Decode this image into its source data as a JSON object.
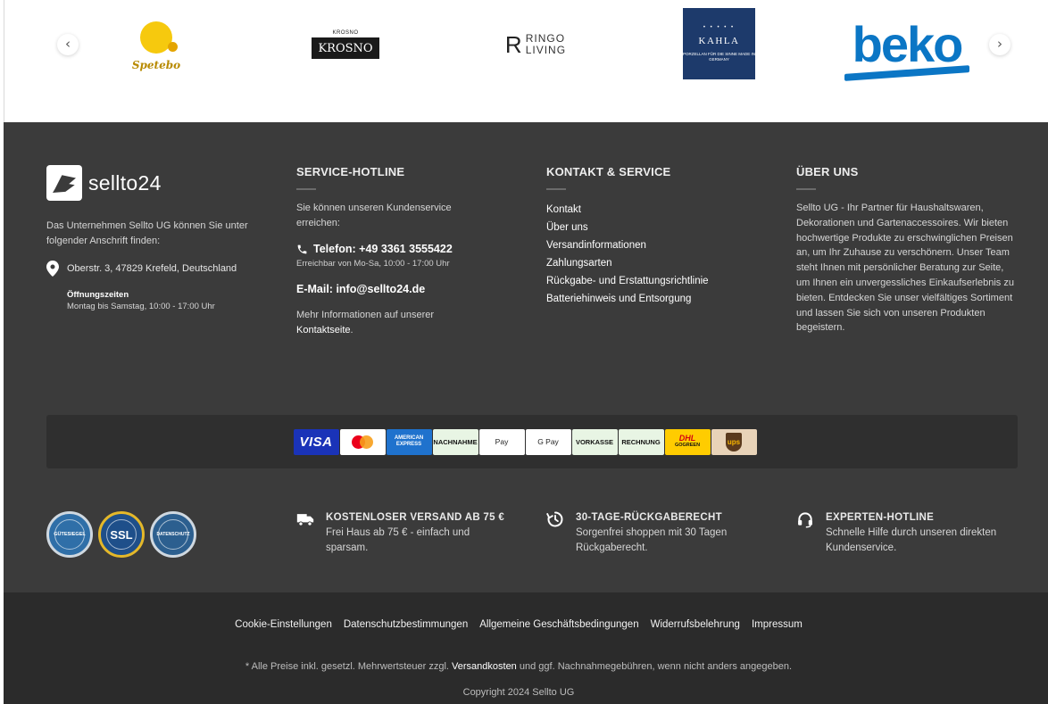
{
  "brands": {
    "prev_label": "‹",
    "next_label": "›",
    "spetebo": "Spetebo",
    "krosno_top": "KROSNO",
    "krosno": "KROSNO",
    "ringo_mark": "R",
    "ringo_line1": "RINGO",
    "ringo_line2": "LIVING",
    "kahla_stars": "• • • • •",
    "kahla": "KAHLA",
    "kahla_sub": "PORZELLAN FÜR DIE SINNE MADE IN GERMANY",
    "beko": "beko"
  },
  "company": {
    "logo_text": "sellto24",
    "intro": "Das Unternehmen Sellto UG können Sie unter folgender Anschrift finden:",
    "address": "Oberstr. 3, 47829 Krefeld, Deutschland",
    "hours_title": "Öffnungszeiten",
    "hours_text": "Montag bis Samstag, 10:00 - 17:00 Uhr"
  },
  "hotline": {
    "title": "SERVICE-HOTLINE",
    "intro": "Sie können unseren Kundenservice erreichen:",
    "phone": "Telefon: +49 3361 3555422",
    "phone_sub": "Erreichbar von Mo-Sa, 10:00 - 17:00 Uhr",
    "email": "E-Mail: info@sellto24.de",
    "more_prefix": "Mehr Informationen auf unserer",
    "more_link": "Kontaktseite",
    "more_suffix": "."
  },
  "contact": {
    "title": "KONTAKT & SERVICE",
    "links": [
      "Kontakt",
      "Über uns",
      "Versandinformationen",
      "Zahlungsarten",
      "Rückgabe- und Erstattungsrichtlinie",
      "Batteriehinweis und Entsorgung"
    ]
  },
  "about": {
    "title": "ÜBER UNS",
    "text": "Sellto UG - Ihr Partner für Haushaltswaren, Dekorationen und Gartenaccessoires. Wir bieten hochwertige Produkte zu erschwinglichen Preisen an, um Ihr Zuhause zu verschönern. Unser Team steht Ihnen mit persönlicher Beratung zur Seite, um Ihnen ein unvergessliches Einkaufserlebnis zu bieten. Entdecken Sie unser vielfältiges Sortiment und lassen Sie sich von unseren Produkten begeistern."
  },
  "payments": {
    "visa": "VISA",
    "mastercard": "mastercard",
    "amex": "AMERICAN EXPRESS",
    "nachnahme": "NACHNAHME",
    "applepay": " Pay",
    "googlepay": "G Pay",
    "vorkasse": "VORKASSE",
    "rechnung": "RECHNUNG",
    "dhl": "DHL",
    "dhl_sub": "GOGREEN",
    "ups": "ups"
  },
  "seals": {
    "s1": "GÜTESIEGEL",
    "s2": "SSL",
    "s3": "DATENSCHUTZ"
  },
  "features": {
    "shipping_title": "KOSTENLOSER VERSAND AB 75 €",
    "shipping_text": "Frei Haus ab 75 € - einfach und sparsam.",
    "returns_title": "30-TAGE-RÜCKGABERECHT",
    "returns_text": "Sorgenfrei shoppen mit 30 Tagen Rückgaberecht.",
    "expert_title": "EXPERTEN-HOTLINE",
    "expert_text": "Schnelle Hilfe durch unseren direkten Kundenservice."
  },
  "legal": {
    "links": [
      "Cookie-Einstellungen",
      "Datenschutzbestimmungen",
      "Allgemeine Geschäftsbedingungen",
      "Widerrufsbelehrung",
      "Impressum"
    ],
    "vat_prefix": "* Alle Preise inkl. gesetzl. Mehrwertsteuer zzgl.",
    "vat_link": "Versandkosten",
    "vat_suffix": "und ggf. Nachnahmegebühren, wenn nicht anders angegeben.",
    "copyright": "Copyright 2024 Sellto UG"
  },
  "colors": {
    "footer_bg": "#3b3b3b",
    "bottom_bg": "#2b2b2b",
    "payments_bg": "#2f2f2f"
  }
}
